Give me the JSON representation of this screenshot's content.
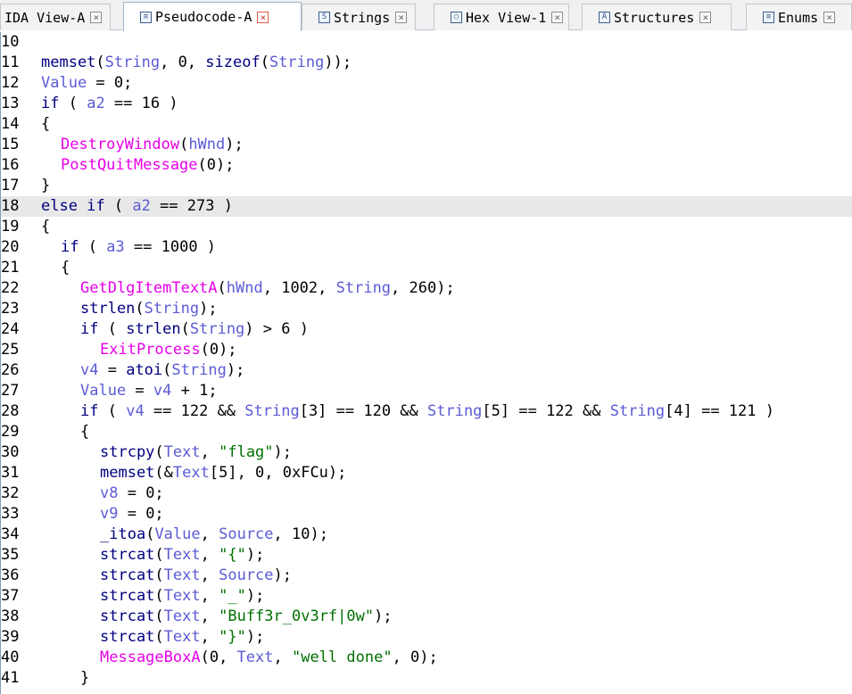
{
  "tabs": [
    {
      "label": "IDA View-A",
      "icon": "none",
      "active": false
    },
    {
      "label": "Pseudocode-A",
      "icon": "pseudocode-icon",
      "active": true
    },
    {
      "label": "Strings",
      "icon": "strings-icon",
      "active": false
    },
    {
      "label": "Hex View-1",
      "icon": "hex-icon",
      "active": false
    },
    {
      "label": "Structures",
      "icon": "structures-icon",
      "active": false
    },
    {
      "label": "Enums",
      "icon": "enums-icon",
      "active": false
    }
  ],
  "highlighted_line": "18",
  "lines": [
    {
      "num": "10",
      "indent": 0,
      "tokens": []
    },
    {
      "num": "11",
      "indent": 0,
      "tokens": [
        [
          "fn",
          "memset"
        ],
        [
          "p",
          "("
        ],
        [
          "var",
          "String"
        ],
        [
          "p",
          ", 0, "
        ],
        [
          "fn",
          "sizeof"
        ],
        [
          "p",
          "("
        ],
        [
          "var",
          "String"
        ],
        [
          "p",
          "));"
        ]
      ]
    },
    {
      "num": "12",
      "indent": 0,
      "tokens": [
        [
          "var",
          "Value"
        ],
        [
          "p",
          " = 0;"
        ]
      ]
    },
    {
      "num": "13",
      "indent": 0,
      "tokens": [
        [
          "kw",
          "if"
        ],
        [
          "p",
          " ( "
        ],
        [
          "var",
          "a2"
        ],
        [
          "p",
          " == 16 )"
        ]
      ]
    },
    {
      "num": "14",
      "indent": 0,
      "tokens": [
        [
          "p",
          "{"
        ]
      ]
    },
    {
      "num": "15",
      "indent": 1,
      "tokens": [
        [
          "imp",
          "DestroyWindow"
        ],
        [
          "p",
          "("
        ],
        [
          "var",
          "hWnd"
        ],
        [
          "p",
          ");"
        ]
      ]
    },
    {
      "num": "16",
      "indent": 1,
      "tokens": [
        [
          "imp",
          "PostQuitMessage"
        ],
        [
          "p",
          "(0);"
        ]
      ]
    },
    {
      "num": "17",
      "indent": 0,
      "tokens": [
        [
          "p",
          "}"
        ]
      ]
    },
    {
      "num": "18",
      "indent": 0,
      "tokens": [
        [
          "kw",
          "else if"
        ],
        [
          "p",
          " ( "
        ],
        [
          "var",
          "a2"
        ],
        [
          "p",
          " == 273 )"
        ]
      ]
    },
    {
      "num": "19",
      "indent": 0,
      "tokens": [
        [
          "p",
          "{"
        ]
      ]
    },
    {
      "num": "20",
      "indent": 1,
      "tokens": [
        [
          "kw",
          "if"
        ],
        [
          "p",
          " ( "
        ],
        [
          "var",
          "a3"
        ],
        [
          "p",
          " == 1000 )"
        ]
      ]
    },
    {
      "num": "21",
      "indent": 1,
      "tokens": [
        [
          "p",
          "{"
        ]
      ]
    },
    {
      "num": "22",
      "indent": 2,
      "tokens": [
        [
          "imp",
          "GetDlgItemTextA"
        ],
        [
          "p",
          "("
        ],
        [
          "var",
          "hWnd"
        ],
        [
          "p",
          ", 1002, "
        ],
        [
          "var",
          "String"
        ],
        [
          "p",
          ", 260);"
        ]
      ]
    },
    {
      "num": "23",
      "indent": 2,
      "tokens": [
        [
          "fn",
          "strlen"
        ],
        [
          "p",
          "("
        ],
        [
          "var",
          "String"
        ],
        [
          "p",
          ");"
        ]
      ]
    },
    {
      "num": "24",
      "indent": 2,
      "tokens": [
        [
          "kw",
          "if"
        ],
        [
          "p",
          " ( "
        ],
        [
          "fn",
          "strlen"
        ],
        [
          "p",
          "("
        ],
        [
          "var",
          "String"
        ],
        [
          "p",
          ") > 6 )"
        ]
      ]
    },
    {
      "num": "25",
      "indent": 3,
      "tokens": [
        [
          "imp",
          "ExitProcess"
        ],
        [
          "p",
          "(0);"
        ]
      ]
    },
    {
      "num": "26",
      "indent": 2,
      "tokens": [
        [
          "var",
          "v4"
        ],
        [
          "p",
          " = "
        ],
        [
          "fn",
          "atoi"
        ],
        [
          "p",
          "("
        ],
        [
          "var",
          "String"
        ],
        [
          "p",
          ");"
        ]
      ]
    },
    {
      "num": "27",
      "indent": 2,
      "tokens": [
        [
          "var",
          "Value"
        ],
        [
          "p",
          " = "
        ],
        [
          "var",
          "v4"
        ],
        [
          "p",
          " + 1;"
        ]
      ]
    },
    {
      "num": "28",
      "indent": 2,
      "tokens": [
        [
          "kw",
          "if"
        ],
        [
          "p",
          " ( "
        ],
        [
          "var",
          "v4"
        ],
        [
          "p",
          " == 122 && "
        ],
        [
          "var",
          "String"
        ],
        [
          "p",
          "[3] == 120 && "
        ],
        [
          "var",
          "String"
        ],
        [
          "p",
          "[5] == 122 && "
        ],
        [
          "var",
          "String"
        ],
        [
          "p",
          "[4] == 121 )"
        ]
      ]
    },
    {
      "num": "29",
      "indent": 2,
      "tokens": [
        [
          "p",
          "{"
        ]
      ]
    },
    {
      "num": "30",
      "indent": 3,
      "tokens": [
        [
          "fn",
          "strcpy"
        ],
        [
          "p",
          "("
        ],
        [
          "var",
          "Text"
        ],
        [
          "p",
          ", "
        ],
        [
          "str",
          "\"flag\""
        ],
        [
          "p",
          ");"
        ]
      ]
    },
    {
      "num": "31",
      "indent": 3,
      "tokens": [
        [
          "fn",
          "memset"
        ],
        [
          "p",
          "(&"
        ],
        [
          "var",
          "Text"
        ],
        [
          "p",
          "[5], 0, 0xFCu);"
        ]
      ]
    },
    {
      "num": "32",
      "indent": 3,
      "tokens": [
        [
          "var",
          "v8"
        ],
        [
          "p",
          " = 0;"
        ]
      ]
    },
    {
      "num": "33",
      "indent": 3,
      "tokens": [
        [
          "var",
          "v9"
        ],
        [
          "p",
          " = 0;"
        ]
      ]
    },
    {
      "num": "34",
      "indent": 3,
      "tokens": [
        [
          "fn",
          "_itoa"
        ],
        [
          "p",
          "("
        ],
        [
          "var",
          "Value"
        ],
        [
          "p",
          ", "
        ],
        [
          "var",
          "Source"
        ],
        [
          "p",
          ", 10);"
        ]
      ]
    },
    {
      "num": "35",
      "indent": 3,
      "tokens": [
        [
          "fn",
          "strcat"
        ],
        [
          "p",
          "("
        ],
        [
          "var",
          "Text"
        ],
        [
          "p",
          ", "
        ],
        [
          "str",
          "\"{\""
        ],
        [
          "p",
          ");"
        ]
      ]
    },
    {
      "num": "36",
      "indent": 3,
      "tokens": [
        [
          "fn",
          "strcat"
        ],
        [
          "p",
          "("
        ],
        [
          "var",
          "Text"
        ],
        [
          "p",
          ", "
        ],
        [
          "var",
          "Source"
        ],
        [
          "p",
          ");"
        ]
      ]
    },
    {
      "num": "37",
      "indent": 3,
      "tokens": [
        [
          "fn",
          "strcat"
        ],
        [
          "p",
          "("
        ],
        [
          "var",
          "Text"
        ],
        [
          "p",
          ", "
        ],
        [
          "str",
          "\"_\""
        ],
        [
          "p",
          ");"
        ]
      ]
    },
    {
      "num": "38",
      "indent": 3,
      "tokens": [
        [
          "fn",
          "strcat"
        ],
        [
          "p",
          "("
        ],
        [
          "var",
          "Text"
        ],
        [
          "p",
          ", "
        ],
        [
          "str",
          "\"Buff3r_0v3rf|0w\""
        ],
        [
          "p",
          ");"
        ]
      ]
    },
    {
      "num": "39",
      "indent": 3,
      "tokens": [
        [
          "fn",
          "strcat"
        ],
        [
          "p",
          "("
        ],
        [
          "var",
          "Text"
        ],
        [
          "p",
          ", "
        ],
        [
          "str",
          "\"}\""
        ],
        [
          "p",
          ");"
        ]
      ]
    },
    {
      "num": "40",
      "indent": 3,
      "tokens": [
        [
          "imp",
          "MessageBoxA"
        ],
        [
          "p",
          "(0, "
        ],
        [
          "var",
          "Text"
        ],
        [
          "p",
          ", "
        ],
        [
          "str",
          "\"well done\""
        ],
        [
          "p",
          ", 0);"
        ]
      ]
    },
    {
      "num": "41",
      "indent": 2,
      "tokens": [
        [
          "p",
          "}"
        ]
      ]
    }
  ]
}
